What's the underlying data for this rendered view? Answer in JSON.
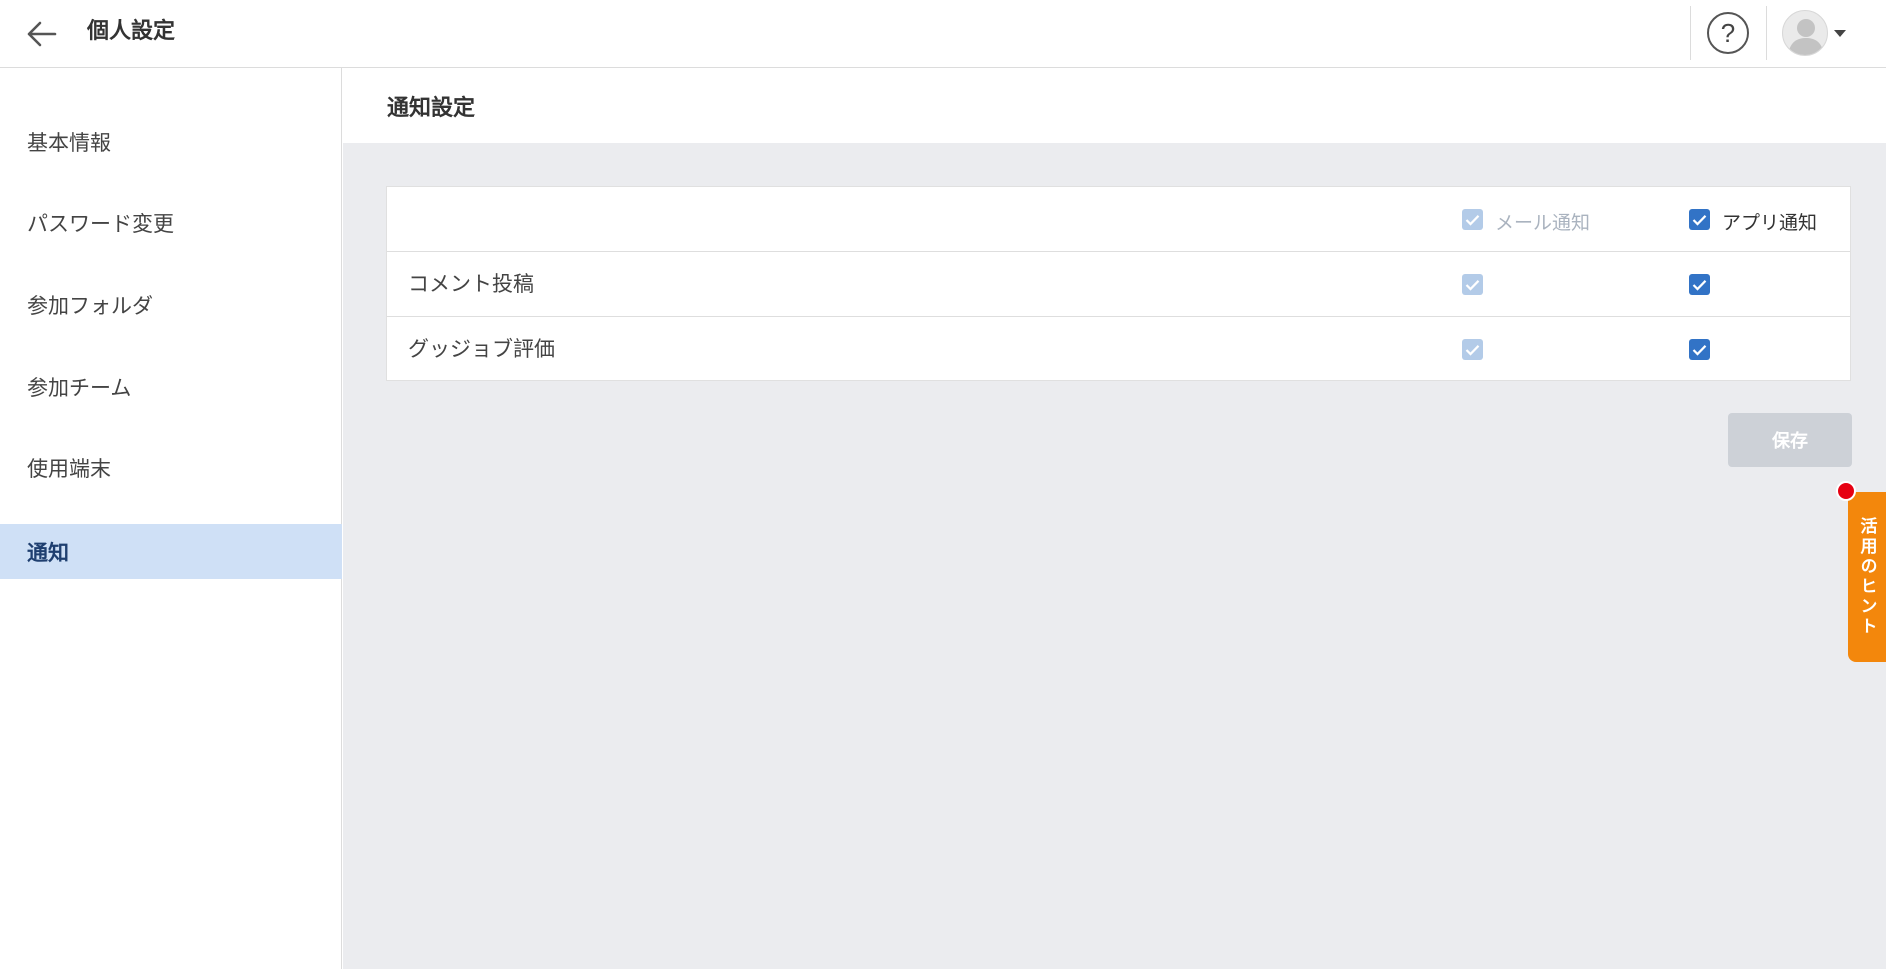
{
  "header": {
    "title": "個人設定",
    "back_icon": "arrow-left-icon",
    "help_label": "?"
  },
  "sidebar": {
    "items": [
      {
        "label": "基本情報",
        "active": false
      },
      {
        "label": "パスワード変更",
        "active": false
      },
      {
        "label": "参加フォルダ",
        "active": false
      },
      {
        "label": "参加チーム",
        "active": false
      },
      {
        "label": "使用端末",
        "active": false
      },
      {
        "label": "通知",
        "active": true
      }
    ]
  },
  "main": {
    "section_title": "通知設定",
    "columns": {
      "mail": {
        "label": "メール通知",
        "checked": true,
        "disabled": true
      },
      "app": {
        "label": "アプリ通知",
        "checked": true,
        "disabled": false
      }
    },
    "rows": [
      {
        "label": "コメント投稿",
        "mail_checked": true,
        "app_checked": true
      },
      {
        "label": "グッジョブ評価",
        "mail_checked": true,
        "app_checked": true
      }
    ],
    "save_label": "保存"
  },
  "hint_tab": {
    "label": "活用のヒント"
  },
  "colors": {
    "accent": "#3273c6",
    "disabled_check": "#b3cbe8",
    "active_sidebar": "#cfe0f6",
    "hint": "#f3870c",
    "badge": "#e60012"
  }
}
